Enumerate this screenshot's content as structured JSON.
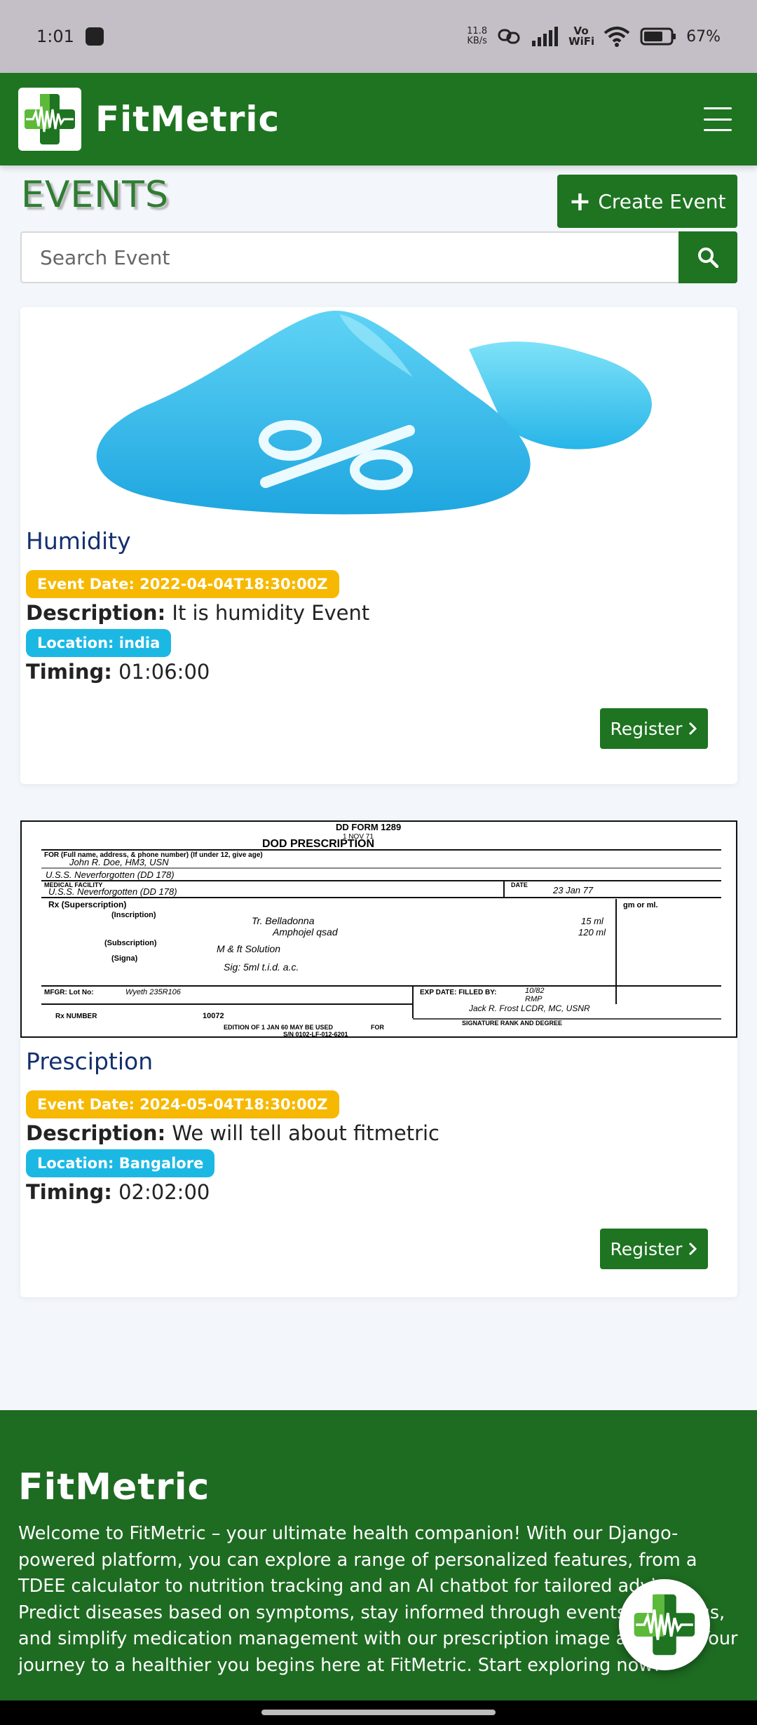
{
  "status_bar": {
    "time": "1:01",
    "net_speed_value": "11.8",
    "net_speed_unit": "KB/s",
    "volte": "Vo WiFi",
    "battery": "67%"
  },
  "header": {
    "brand": "FitMetric"
  },
  "events": {
    "title": "EVENTS",
    "create_label": "Create Event",
    "search_placeholder": "Search Event"
  },
  "event_cards": [
    {
      "name": "Humidity",
      "date_badge": "Event Date: 2022-04-04T18:30:00Z",
      "description_label": "Description:",
      "description": "It is humidity Event",
      "location_badge": "Location: india",
      "timing_label": "Timing:",
      "timing": "01:06:00",
      "register_label": "Register"
    },
    {
      "name": "Presciption",
      "date_badge": "Event Date: 2024-05-04T18:30:00Z",
      "description_label": "Description:",
      "description": "We will tell about fitmetric",
      "location_badge": "Location: Bangalore",
      "timing_label": "Timing:",
      "timing": "02:02:00",
      "register_label": "Register"
    }
  ],
  "prescription_image": {
    "form_top": "DD FORM 1289",
    "form_date": "1 NOV 71",
    "form_title": "DOD PRESCRIPTION",
    "for_line": "FOR (Full name, address, & phone number) (If under 12, give age)",
    "patient": "John R. Doe, HM3, USN",
    "patient_address": "U.S.S. Neverforgotten (DD 178)",
    "facility_label": "MEDICAL FACILITY",
    "facility": "U.S.S. Neverforgotten (DD 178)",
    "date_label": "DATE",
    "date": "23 Jan 77",
    "rx": "Rx (Superscription)",
    "inscription_label": "(Inscription)",
    "inscription_1": "Tr. Belladonna",
    "inscription_2": "Amphojel qsad",
    "unit_label": "gm or ml.",
    "qty_1": "15 ml",
    "qty_2": "120 ml",
    "subscription_label": "(Subscription)",
    "subscription": "M & ft Solution",
    "signa_label": "(Signa)",
    "signa": "Sig: 5ml t.i.d. a.c.",
    "mfgr_label": "MFGR: Lot No:",
    "mfgr": "Wyeth 235R106",
    "exp_label": "EXP DATE: FILLED BY:",
    "exp": "10/82",
    "filled_by": "RMP",
    "doctor": "Jack R. Frost LCDR, MC, USNR",
    "rx_number_label": "Rx NUMBER",
    "rx_number": "10072",
    "signature_label": "SIGNATURE RANK AND DEGREE",
    "edition": "EDITION OF 1 JAN 60 MAY BE USED",
    "sn": "S/N 0102-LF-012-6201",
    "for_label": "FOR"
  },
  "footer": {
    "title": "FitMetric",
    "text": "Welcome to FitMetric – your ultimate health companion! With our Django-powered platform, you can explore a range of personalized features, from a TDEE calculator to nutrition tracking and an AI chatbot for tailored advice. Predict diseases based on symptoms, stay informed through events and blogs, and simplify medication management with our prescription image analysis. Your journey to a healthier you begins here at FitMetric. Start exploring now!"
  },
  "icons": {
    "brand": "medical-cross-pulse-icon",
    "menu": "hamburger-menu-icon",
    "search": "search-icon",
    "plus": "plus-icon",
    "chevron": "chevron-right-icon",
    "chatbot": "medical-cross-pulse-icon"
  },
  "colors": {
    "primary_green": "#1e7421",
    "footer_green": "#1e6b22",
    "title_navy": "#14306e",
    "date_badge": "#f6b800",
    "location_badge": "#1cb8e4"
  }
}
